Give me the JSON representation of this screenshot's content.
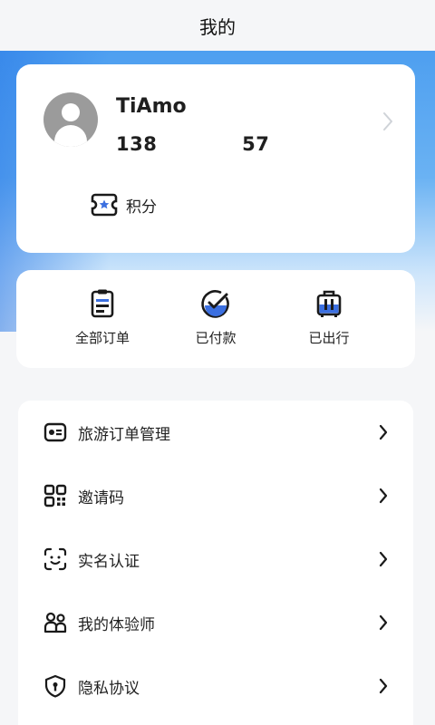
{
  "header": {
    "title": "我的"
  },
  "profile": {
    "name": "TiAmo",
    "phone_prefix": "138",
    "phone_suffix": "57",
    "points_label": "积分"
  },
  "orders": [
    {
      "label": "全部订单",
      "icon": "clipboard-icon"
    },
    {
      "label": "已付款",
      "icon": "check-circle-icon"
    },
    {
      "label": "已出行",
      "icon": "luggage-icon"
    }
  ],
  "menu": [
    {
      "label": "旅游订单管理",
      "icon": "id-card-icon"
    },
    {
      "label": "邀请码",
      "icon": "qr-code-icon"
    },
    {
      "label": "实名认证",
      "icon": "face-scan-icon"
    },
    {
      "label": "我的体验师",
      "icon": "users-icon"
    },
    {
      "label": "隐私协议",
      "icon": "shield-icon"
    }
  ],
  "colors": {
    "accent": "#3b6fe0",
    "primary_bg": "#4e9ff0"
  }
}
